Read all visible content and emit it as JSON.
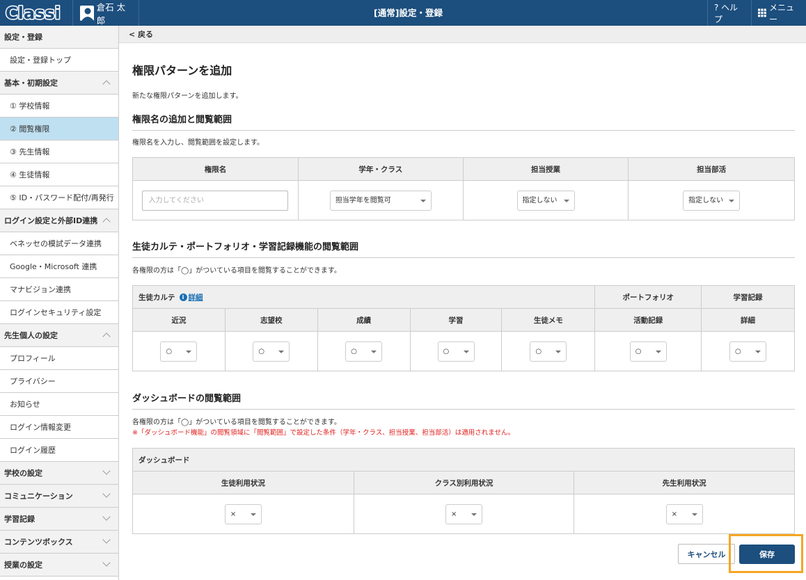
{
  "header": {
    "logo": "Classi",
    "user_name": "倉石 太郎",
    "title": "[通常]設定・登録",
    "help_label": "? ヘルプ",
    "menu_label": "メニュー"
  },
  "sidebar": {
    "items": [
      {
        "label": "設定・登録",
        "type": "section"
      },
      {
        "label": "設定・登録トップ"
      },
      {
        "label": "基本・初期設定",
        "type": "section",
        "chevron": "up"
      },
      {
        "label": "① 学校情報"
      },
      {
        "label": "② 閲覧権限",
        "active": true
      },
      {
        "label": "③ 先生情報"
      },
      {
        "label": "④ 生徒情報"
      },
      {
        "label": "⑤ ID・パスワード配付/再発行"
      },
      {
        "label": "ログイン設定と外部ID連携",
        "type": "section",
        "chevron": "up"
      },
      {
        "label": "ベネッセの模試データ連携"
      },
      {
        "label": "Google・Microsoft 連携"
      },
      {
        "label": "マナビジョン連携"
      },
      {
        "label": "ログインセキュリティ設定"
      },
      {
        "label": "先生個人の設定",
        "type": "section",
        "chevron": "up"
      },
      {
        "label": "プロフィール"
      },
      {
        "label": "プライバシー"
      },
      {
        "label": "お知らせ"
      },
      {
        "label": "ログイン情報変更"
      },
      {
        "label": "ログイン履歴"
      },
      {
        "label": "学校の設定",
        "type": "section",
        "chevron": "down"
      },
      {
        "label": "コミュニケーション",
        "type": "section",
        "chevron": "down"
      },
      {
        "label": "学習記録",
        "type": "section",
        "chevron": "down"
      },
      {
        "label": "コンテンツボックス",
        "type": "section",
        "chevron": "down"
      },
      {
        "label": "授業の設定",
        "type": "section",
        "chevron": "down"
      }
    ]
  },
  "main": {
    "back_label": "< 戻る",
    "page_title": "権限パターンを追加",
    "intro": "新たな権限パターンを追加します。",
    "section1": {
      "heading": "権限名の追加と閲覧範囲",
      "desc": "権限名を入力し、閲覧範囲を設定します。",
      "headers": [
        "権限名",
        "学年・クラス",
        "担当授業",
        "担当部活"
      ],
      "name_placeholder": "入力してください",
      "grade_value": "担当学年を閲覧可",
      "class_value": "指定しない",
      "club_value": "指定しない"
    },
    "section2": {
      "heading": "生徒カルテ・ポートフォリオ・学習記録機能の閲覧範囲",
      "desc": "各権限の方は「◯」がついている項目を閲覧することができます。",
      "group_karte": "生徒カルテ",
      "detail_link": "詳細",
      "group_portfolio": "ポートフォリオ",
      "group_record": "学習記録",
      "sub_headers": [
        "近況",
        "志望校",
        "成績",
        "学習",
        "生徒メモ",
        "活動記録",
        "詳細"
      ],
      "values": [
        "○",
        "○",
        "○",
        "○",
        "○",
        "○",
        "○"
      ]
    },
    "section3": {
      "heading": "ダッシュボードの閲覧範囲",
      "desc": "各権限の方は「◯」がついている項目を閲覧することができます。",
      "note": "※「ダッシュボード機能」の閲覧領域に「閲覧範囲」で設定した条件（学年・クラス、担当授業、担当部活）は適用されません。",
      "group": "ダッシュボード",
      "headers": [
        "生徒利用状況",
        "クラス別利用状況",
        "先生利用状況"
      ],
      "values": [
        "×",
        "×",
        "×"
      ]
    },
    "cancel_label": "キャンセル",
    "save_label": "保存"
  }
}
